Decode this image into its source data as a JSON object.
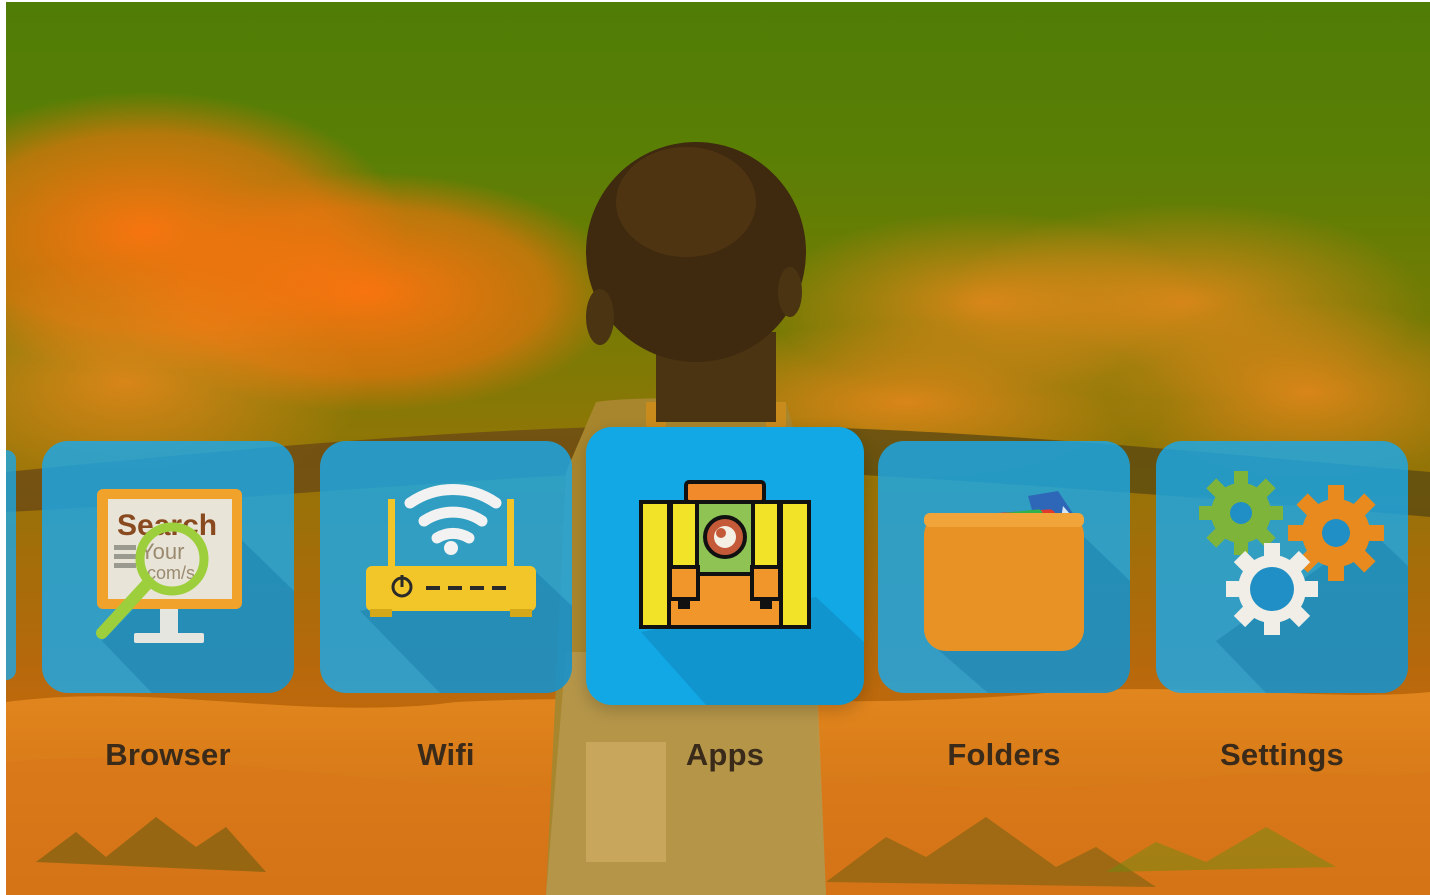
{
  "launcher": {
    "items": [
      {
        "label": "Browser",
        "icon": "browser-icon",
        "focused": false
      },
      {
        "label": "Wifi",
        "icon": "wifi-router-icon",
        "focused": false
      },
      {
        "label": "Apps",
        "icon": "apps-briefcase-icon",
        "focused": true
      },
      {
        "label": "Folders",
        "icon": "folder-icon",
        "focused": false
      },
      {
        "label": "Settings",
        "icon": "gears-icon",
        "focused": false
      }
    ],
    "browser_icon_text": {
      "line1": "Search",
      "line2": "Your",
      "line3": ".com/s"
    }
  },
  "colors": {
    "tile": "#18a8eb",
    "tile_focused": "#12a8e6",
    "label": "#3a2a1a",
    "overlay_top": "#507d06",
    "overlay_bottom": "#d56c0c"
  }
}
